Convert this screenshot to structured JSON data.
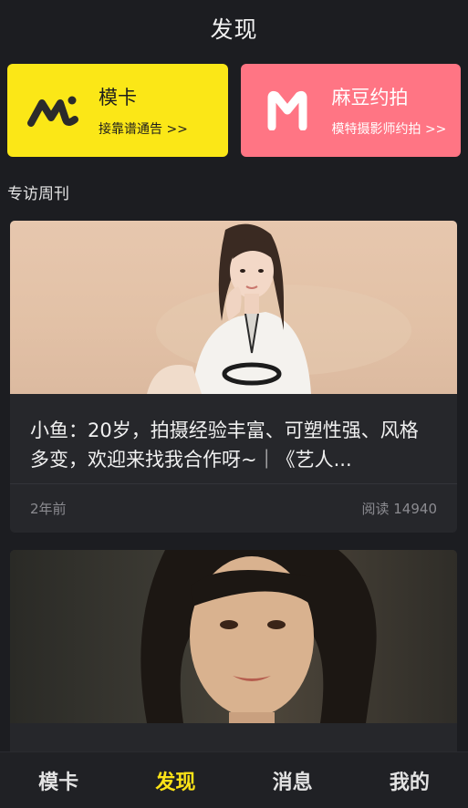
{
  "header": {
    "title": "发现"
  },
  "promos": [
    {
      "title": "模卡",
      "subtitle": "接靠谱通告 >>",
      "color": "#fbe717"
    },
    {
      "title": "麻豆约拍",
      "subtitle": "模特摄影师约拍 >>",
      "color": "#ff7584"
    }
  ],
  "section": {
    "title": "专访周刊"
  },
  "articles": [
    {
      "caption": "小鱼：20岁，拍摄经验丰富、可塑性强、风格多变，欢迎来找我合作呀~｜《艺人...",
      "time": "2年前",
      "reads": "阅读 14940"
    }
  ],
  "tabbar": {
    "items": [
      "模卡",
      "发现",
      "消息",
      "我的"
    ],
    "active_index": 1,
    "accent": "#fbe317"
  }
}
